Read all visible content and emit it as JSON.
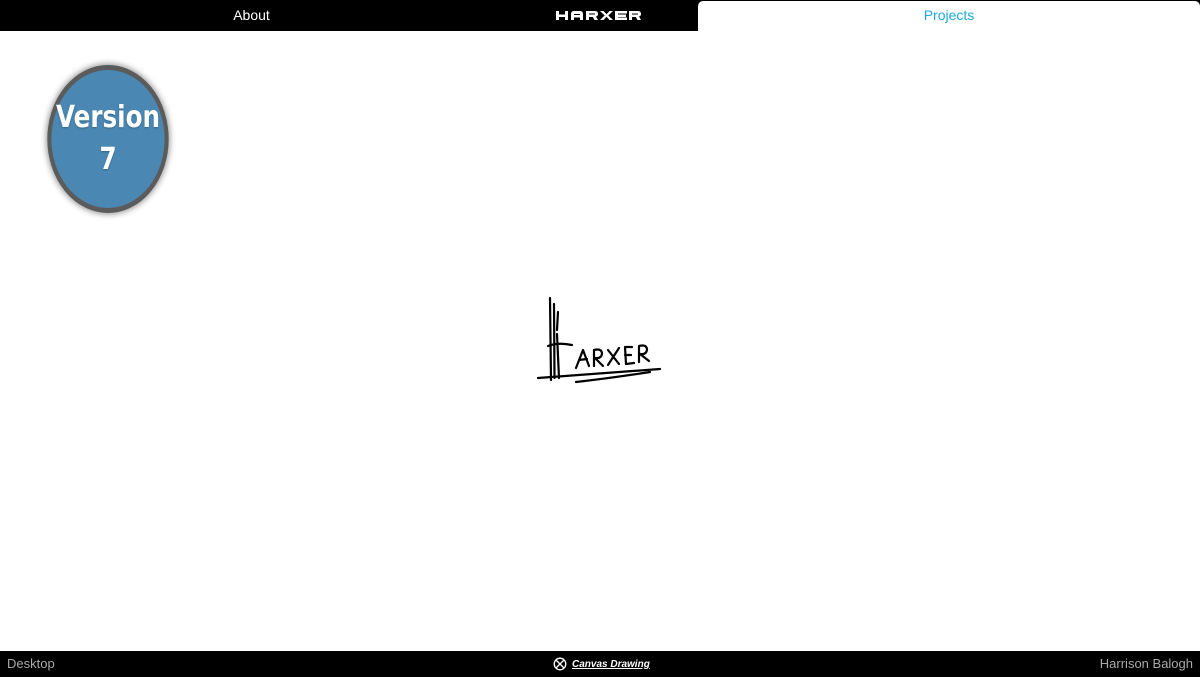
{
  "nav": {
    "about_label": "About",
    "logo_text": "HARXER",
    "projects_label": "Projects",
    "projects_active": true,
    "colors": {
      "bar": "#000000",
      "active_tab_bg": "#ffffff",
      "active_tab_text": "#1ba8dc"
    }
  },
  "badge": {
    "line1": "Version",
    "line2": "7",
    "colors": {
      "fill": "#4a88b3",
      "ring": "#5b5b5b"
    }
  },
  "signature": {
    "text": "HARXER",
    "icon": "handwritten-signature-logo"
  },
  "footer": {
    "left_label": "Desktop",
    "center_icon": "crossed-circle-icon",
    "center_label": "Canvas Drawing",
    "right_label": "Harrison Balogh"
  }
}
